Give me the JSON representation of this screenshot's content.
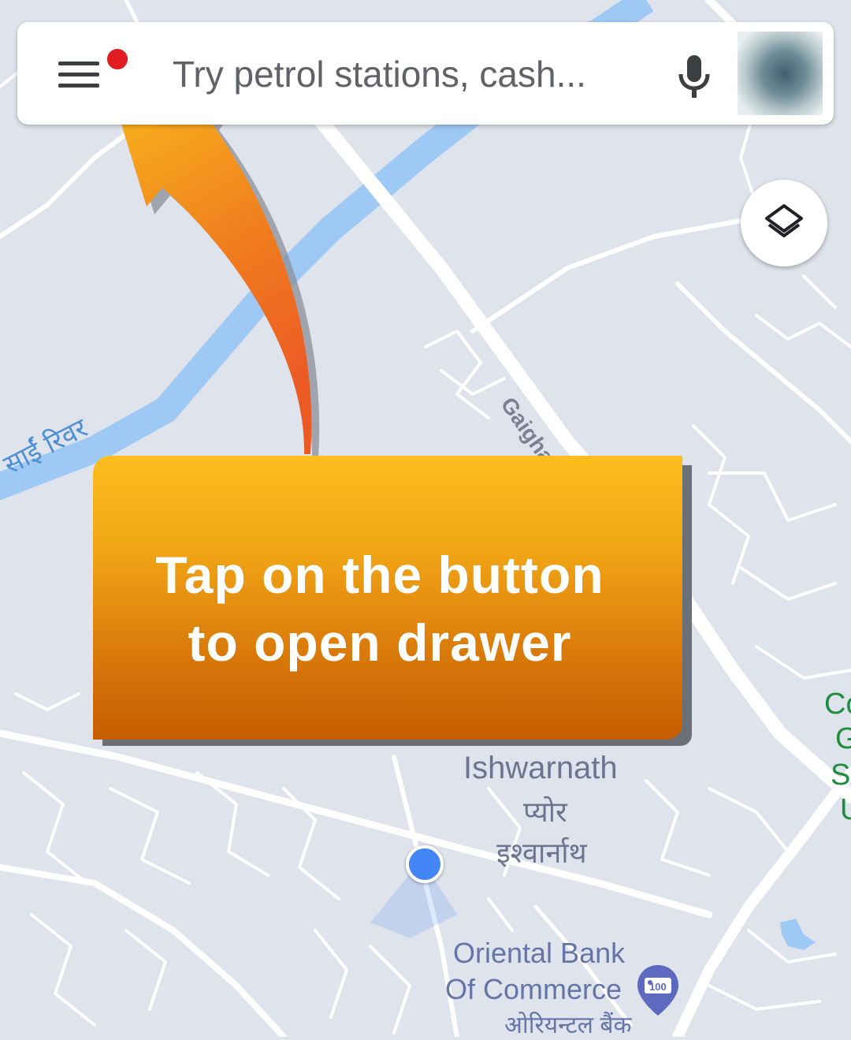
{
  "search": {
    "placeholder": "Try petrol stations, cash..."
  },
  "map": {
    "labels": {
      "river": "साईं रिवर",
      "gaighat": "Gaighat",
      "ishwarnath_en": "Ishwarnath",
      "ishwarnath_hi1": "प्योर",
      "ishwarnath_hi2": "इश्वार्नाथ",
      "bank_line1": "Oriental Bank",
      "bank_line2": "Of Commerce",
      "bank_hi": "ओरियन्टल बैंक",
      "bank_badge": "100",
      "right_edge_1": "Co",
      "right_edge_2": "G",
      "right_edge_3": "S",
      "right_edge_4": "U"
    },
    "colors": {
      "land": "#dfe3ec",
      "road": "#ffffff",
      "river": "#9fc9f5",
      "label": "#6b7590"
    }
  },
  "callout": {
    "line1": "Tap on the button",
    "line2": "to open drawer"
  },
  "icons": {
    "menu": "hamburger-menu-icon",
    "notification": "notification-dot-icon",
    "mic": "microphone-icon",
    "layers": "layers-icon",
    "location": "current-location-icon",
    "bank": "bank-pin-icon",
    "arrow": "curved-arrow-annotation"
  },
  "accent": {
    "notification_dot": "#e11d22",
    "location": "#4285f4",
    "callout_top": "#fcbf1e",
    "callout_bottom": "#c65d02"
  }
}
